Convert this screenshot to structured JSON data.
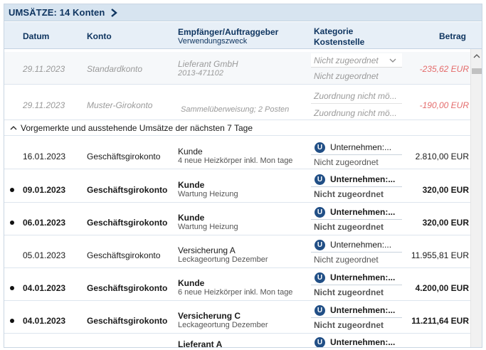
{
  "panel": {
    "title": "UMSÄTZE: 14 Konten",
    "title_chevron_icon": "chevron-right-icon"
  },
  "columns": {
    "datum": "Datum",
    "konto": "Konto",
    "empfaenger": "Empfänger/Auftraggeber",
    "verwendungszweck": "Verwendungszweck",
    "kategorie": "Kategorie",
    "kostenstelle": "Kostenstelle",
    "betrag": "Betrag"
  },
  "pending_rows": [
    {
      "date": "29.11.2023",
      "account": "Standardkonto",
      "recipient": "Lieferant GmbH",
      "purpose": "2013-471102",
      "category": "Nicht zugeordnet",
      "cost_center": "Nicht zugeordnet",
      "amount": "-235,62 EUR"
    },
    {
      "date": "29.11.2023",
      "account": "Muster-Girokonto",
      "recipient": "",
      "purpose": "Sammelüberweisung; 2 Posten",
      "category": "Zuordnung nicht mö...",
      "cost_center": "Zuordnung nicht mö...",
      "amount": "-190,00 EUR"
    }
  ],
  "section": {
    "label": "Vorgemerkte und ausstehende Umsätze der nächsten 7 Tage",
    "icon": "chevron-up-icon"
  },
  "rows": [
    {
      "unread": false,
      "date": "16.01.2023",
      "account": "Geschäftsgirokonto",
      "recipient": "Kunde",
      "purpose": "4 neue Heizkörper inkl. Mon tage",
      "category": "Unternehmen:...",
      "cost_center": "Nicht zugeordnet",
      "amount": "2.810,00 EUR"
    },
    {
      "unread": true,
      "date": "09.01.2023",
      "account": "Geschäftsgirokonto",
      "recipient": "Kunde",
      "purpose": "Wartung Heizung",
      "category": "Unternehmen:...",
      "cost_center": "Nicht zugeordnet",
      "amount": "320,00 EUR"
    },
    {
      "unread": true,
      "date": "06.01.2023",
      "account": "Geschäftsgirokonto",
      "recipient": "Kunde",
      "purpose": "Wartung Heizung",
      "category": "Unternehmen:...",
      "cost_center": "Nicht zugeordnet",
      "amount": "320,00 EUR"
    },
    {
      "unread": false,
      "date": "05.01.2023",
      "account": "Geschäftsgirokonto",
      "recipient": "Versicherung A",
      "purpose": "Leckageortung Dezember",
      "category": "Unternehmen:...",
      "cost_center": "Nicht zugeordnet",
      "amount": "11.955,81 EUR"
    },
    {
      "unread": true,
      "date": "04.01.2023",
      "account": "Geschäftsgirokonto",
      "recipient": "Kunde",
      "purpose": "6 neue Heizkörper inkl. Mon tage",
      "category": "Unternehmen:...",
      "cost_center": "Nicht zugeordnet",
      "amount": "4.200,00 EUR"
    },
    {
      "unread": true,
      "date": "04.01.2023",
      "account": "Geschäftsgirokonto",
      "recipient": "Versicherung C",
      "purpose": "Leckageortung Dezember",
      "category": "Unternehmen:...",
      "cost_center": "Nicht zugeordnet",
      "amount": "11.211,64 EUR"
    },
    {
      "unread": true,
      "date": "",
      "account": "",
      "recipient": "Lieferant A",
      "purpose": "",
      "category": "Unternehmen:...",
      "cost_center": "",
      "amount": ""
    }
  ],
  "colors": {
    "header_text": "#0f3560",
    "negative_amount": "#e46b6b",
    "category_icon": "#214f86"
  }
}
